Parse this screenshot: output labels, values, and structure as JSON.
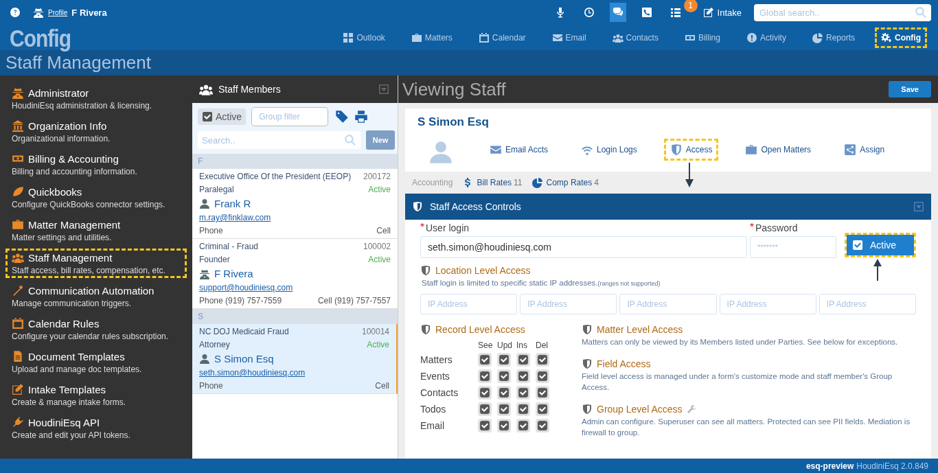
{
  "topbar": {
    "profile_link": "Profile",
    "user_name": "F Rivera",
    "tools": [
      {
        "selected": false
      },
      {
        "selected": false
      },
      {
        "selected": true
      },
      {
        "selected": false
      },
      {
        "selected": false,
        "badge": "1"
      }
    ],
    "intake": "Intake",
    "search": {
      "placeholder": "Global search.."
    }
  },
  "logo": "Config",
  "nav": [
    {
      "label": "Outlook",
      "selected": false,
      "highlighted": false
    },
    {
      "label": "Matters",
      "selected": false,
      "highlighted": false
    },
    {
      "label": "Calendar",
      "selected": false,
      "highlighted": false
    },
    {
      "label": "Email",
      "selected": false,
      "highlighted": false
    },
    {
      "label": "Contacts",
      "selected": false,
      "highlighted": false
    },
    {
      "label": "Billing",
      "selected": false,
      "highlighted": false
    },
    {
      "label": "Activity",
      "selected": false,
      "highlighted": false
    },
    {
      "label": "Reports",
      "selected": false,
      "highlighted": false
    },
    {
      "label": "Config",
      "selected": true,
      "highlighted": true
    }
  ],
  "page_title": "Staff Management",
  "sidebar": {
    "items": [
      {
        "title": "Administrator",
        "description": "HoudiniEsq administration & licensing.",
        "highlighted": false
      },
      {
        "title": "Organization Info",
        "description": "Organizational information.",
        "highlighted": false
      },
      {
        "title": "Billing & Accounting",
        "description": "Billing and accounting information.",
        "highlighted": false
      },
      {
        "title": "Quickbooks",
        "description": "Configure QuickBooks connector settings.",
        "highlighted": false
      },
      {
        "title": "Matter Management",
        "description": "Matter settings and utilities.",
        "highlighted": false
      },
      {
        "title": "Staff Management",
        "description": "Staff access, bill rates, compensation, etc.",
        "highlighted": true
      },
      {
        "title": "Communication Automation",
        "description": "Manage communication triggers.",
        "highlighted": false
      },
      {
        "title": "Calendar Rules",
        "description": "Configure your calendar rules subscription.",
        "highlighted": false
      },
      {
        "title": "Document Templates",
        "description": "Upload and manage doc templates.",
        "highlighted": false
      },
      {
        "title": "Intake Templates",
        "description": "Create & manage intake forms.",
        "highlighted": false
      },
      {
        "title": "HoudiniEsq API",
        "description": "Create and edit your API tokens.",
        "highlighted": false
      }
    ]
  },
  "staff_list": {
    "title": "Staff Members",
    "active_filter": {
      "label": "Active",
      "checked": true
    },
    "group_filter": {
      "placeholder": "Group filter"
    },
    "search": {
      "placeholder": "Search.."
    },
    "new_button": "New",
    "groups": [
      {
        "letter": "F",
        "members": [
          {
            "org": "Executive Office Of the President (EEOP)",
            "number": "200172",
            "role": "Paralegal",
            "status": "Active",
            "kind": "user",
            "name": "Frank R",
            "email": "m.ray@finklaw.com",
            "phone": "Phone",
            "cell": "Cell",
            "selected": false
          },
          {
            "org": "Criminal - Fraud",
            "number": "100002",
            "role": "Founder",
            "status": "Active",
            "kind": "admin",
            "name": "F Rivera",
            "email": "support@houdiniesq.com",
            "phone": "Phone (919) 757-7559",
            "cell": "Cell (919) 757-7557",
            "selected": false
          }
        ]
      },
      {
        "letter": "S",
        "members": [
          {
            "org": "NC DOJ Medicaid Fraud",
            "number": "100014",
            "role": "Attorney",
            "status": "Active",
            "kind": "user",
            "name": "S Simon Esq",
            "email": "seth.simon@houdiniesq.com",
            "phone": "Phone",
            "cell": "Cell",
            "selected": true
          }
        ]
      }
    ]
  },
  "detail": {
    "title": "Viewing Staff",
    "save": "Save",
    "name": "S Simon Esq",
    "tabs": [
      {
        "label": "Email Accts",
        "highlighted": false
      },
      {
        "label": "Login Logs",
        "highlighted": false
      },
      {
        "label": "Access",
        "highlighted": true
      },
      {
        "label": "Open Matters",
        "highlighted": false
      },
      {
        "label": "Assign",
        "highlighted": false
      }
    ],
    "accounting": {
      "label": "Accounting",
      "links": [
        {
          "label": "Bill Rates",
          "count": "11"
        },
        {
          "label": "Comp Rates",
          "count": "4"
        }
      ]
    },
    "access": {
      "title": "Staff Access Controls",
      "user_login": {
        "label": "User login",
        "required": true,
        "value": "seth.simon@houdiniesq.com"
      },
      "password": {
        "label": "Password",
        "required": true,
        "value": "*******"
      },
      "active": {
        "label": "Active",
        "checked": true,
        "highlighted": true
      },
      "location": {
        "title": "Location Level Access",
        "description": "Staff login is limited to specific static IP addresses.",
        "note": "(ranges not supported)",
        "ip_fields": [
          {
            "placeholder": "IP Address"
          },
          {
            "placeholder": "IP Address"
          },
          {
            "placeholder": "IP Address"
          },
          {
            "placeholder": "IP Address"
          },
          {
            "placeholder": "IP Address"
          }
        ]
      },
      "record": {
        "title": "Record Level Access",
        "columns": [
          "See",
          "Upd",
          "Ins",
          "Del"
        ],
        "rows": [
          {
            "label": "Matters",
            "checks": [
              true,
              true,
              true,
              true
            ]
          },
          {
            "label": "Events",
            "checks": [
              true,
              true,
              true,
              true
            ]
          },
          {
            "label": "Contacts",
            "checks": [
              true,
              true,
              true,
              true
            ]
          },
          {
            "label": "Todos",
            "checks": [
              true,
              true,
              true,
              true
            ]
          },
          {
            "label": "Email",
            "checks": [
              true,
              true,
              true,
              true
            ]
          }
        ]
      },
      "sections": [
        {
          "title": "Matter Level Access",
          "wrench": false,
          "description": "Matters can only be viewed by its Members listed under Parties. See below for exceptions."
        },
        {
          "title": "Field Access",
          "wrench": false,
          "description": "Field level access is managed under a form's customize mode and staff member's Group Access."
        },
        {
          "title": "Group Level Access",
          "wrench": true,
          "description": "Admin can configure. Superuser can see all matters. Protected can see PII fields. Mediation is firewall to group."
        }
      ]
    }
  },
  "footer": {
    "env": "esq-preview",
    "version": "HoudiniEsq 2.0.849"
  }
}
